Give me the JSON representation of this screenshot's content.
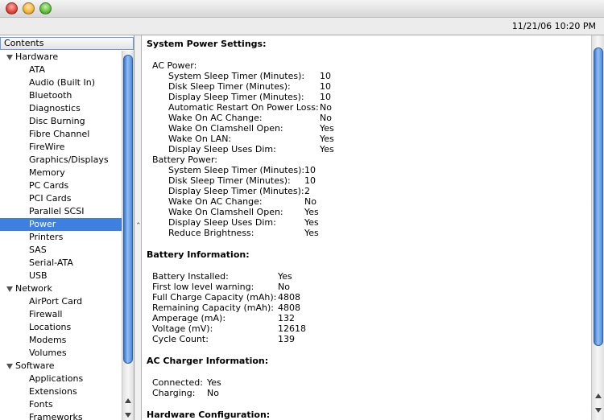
{
  "toolbar": {
    "datetime": "11/21/06 10:20 PM"
  },
  "sidebar": {
    "header": "Contents",
    "rows": [
      {
        "kind": "cat",
        "label": "Hardware"
      },
      {
        "kind": "item",
        "label": "ATA"
      },
      {
        "kind": "item",
        "label": "Audio (Built In)"
      },
      {
        "kind": "item",
        "label": "Bluetooth"
      },
      {
        "kind": "item",
        "label": "Diagnostics"
      },
      {
        "kind": "item",
        "label": "Disc Burning"
      },
      {
        "kind": "item",
        "label": "Fibre Channel"
      },
      {
        "kind": "item",
        "label": "FireWire"
      },
      {
        "kind": "item",
        "label": "Graphics/Displays"
      },
      {
        "kind": "item",
        "label": "Memory"
      },
      {
        "kind": "item",
        "label": "PC Cards"
      },
      {
        "kind": "item",
        "label": "PCI Cards"
      },
      {
        "kind": "item",
        "label": "Parallel SCSI"
      },
      {
        "kind": "item",
        "label": "Power",
        "selected": true
      },
      {
        "kind": "item",
        "label": "Printers"
      },
      {
        "kind": "item",
        "label": "SAS"
      },
      {
        "kind": "item",
        "label": "Serial-ATA"
      },
      {
        "kind": "item",
        "label": "USB"
      },
      {
        "kind": "cat",
        "label": "Network"
      },
      {
        "kind": "item",
        "label": "AirPort Card"
      },
      {
        "kind": "item",
        "label": "Firewall"
      },
      {
        "kind": "item",
        "label": "Locations"
      },
      {
        "kind": "item",
        "label": "Modems"
      },
      {
        "kind": "item",
        "label": "Volumes"
      },
      {
        "kind": "cat",
        "label": "Software"
      },
      {
        "kind": "item",
        "label": "Applications"
      },
      {
        "kind": "item",
        "label": "Extensions"
      },
      {
        "kind": "item",
        "label": "Fonts"
      },
      {
        "kind": "item",
        "label": "Frameworks"
      }
    ]
  },
  "content": {
    "system_power": {
      "title": "System Power Settings:",
      "ac": {
        "label": "AC Power:",
        "rows": [
          {
            "k": "System Sleep Timer (Minutes):",
            "v": "10"
          },
          {
            "k": "Disk Sleep Timer (Minutes):",
            "v": "10"
          },
          {
            "k": "Display Sleep Timer (Minutes):",
            "v": "10"
          },
          {
            "k": "Automatic Restart On Power Loss:",
            "v": "No"
          },
          {
            "k": "Wake On AC Change:",
            "v": "No"
          },
          {
            "k": "Wake On Clamshell Open:",
            "v": "Yes"
          },
          {
            "k": "Wake On LAN:",
            "v": "Yes"
          },
          {
            "k": "Display Sleep Uses Dim:",
            "v": "Yes"
          }
        ]
      },
      "battery": {
        "label": "Battery Power:",
        "rows": [
          {
            "k": "System Sleep Timer (Minutes):",
            "v": "10"
          },
          {
            "k": "Disk Sleep Timer (Minutes):",
            "v": "10"
          },
          {
            "k": "Display Sleep Timer (Minutes):",
            "v": "2"
          },
          {
            "k": "Wake On AC Change:",
            "v": "No"
          },
          {
            "k": "Wake On Clamshell Open:",
            "v": "Yes"
          },
          {
            "k": "Display Sleep Uses Dim:",
            "v": "Yes"
          },
          {
            "k": "Reduce Brightness:",
            "v": "Yes"
          }
        ]
      }
    },
    "battery_info": {
      "title": "Battery Information:",
      "rows": [
        {
          "k": "Battery Installed:",
          "v": "Yes"
        },
        {
          "k": "First low level warning:",
          "v": "No"
        },
        {
          "k": "Full Charge Capacity (mAh):",
          "v": "4808"
        },
        {
          "k": "Remaining Capacity (mAh):",
          "v": "4808"
        },
        {
          "k": "Amperage (mA):",
          "v": "132"
        },
        {
          "k": "Voltage (mV):",
          "v": "12618"
        },
        {
          "k": "Cycle Count:",
          "v": "139"
        }
      ]
    },
    "ac_charger": {
      "title": "AC Charger Information:",
      "rows": [
        {
          "k": "Connected:",
          "v": "Yes"
        },
        {
          "k": "Charging:",
          "v": "No"
        }
      ]
    },
    "hardware_config": {
      "title": "Hardware Configuration:"
    }
  }
}
